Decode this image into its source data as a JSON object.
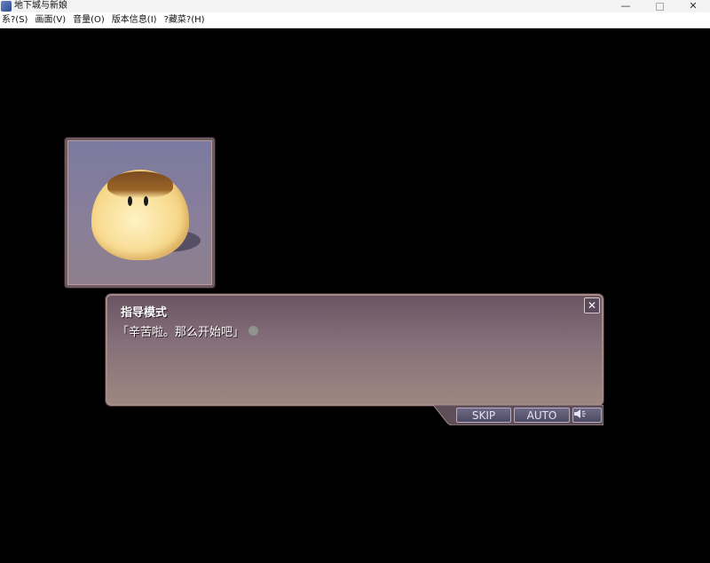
{
  "window": {
    "title": "地下城与新娘",
    "minimize": "—",
    "close": "✕"
  },
  "menu": [
    {
      "label": "系?(S)"
    },
    {
      "label": "画面(V)"
    },
    {
      "label": "音量(O)"
    },
    {
      "label": "版本信息(I)"
    },
    {
      "label": "?藏菜?(H)"
    }
  ],
  "dialog": {
    "speaker": "指导模式",
    "message": "「辛苦啦。那么开始吧」",
    "close_label": "✕"
  },
  "controls": {
    "skip": "SKIP",
    "auto": "AUTO",
    "sound_icon": "speaker-icon"
  },
  "colors": {
    "background": "#000000",
    "dialog": "#86707a",
    "button": "#5a5672"
  }
}
